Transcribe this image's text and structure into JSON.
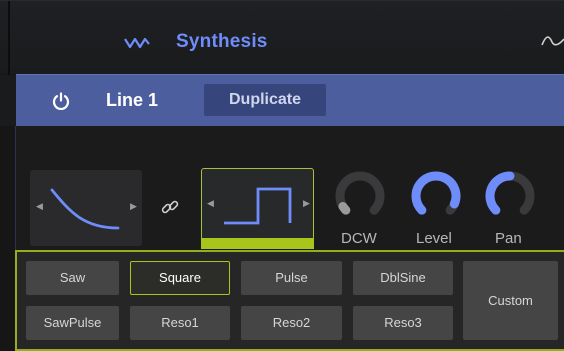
{
  "header": {
    "title": "Synthesis"
  },
  "line": {
    "title": "Line 1",
    "duplicate_label": "Duplicate"
  },
  "knobs": [
    {
      "label": "DCW",
      "level": 0.05,
      "color": "#9a9a9a"
    },
    {
      "label": "Level",
      "level": 0.92,
      "color": "#6f8dfa"
    },
    {
      "label": "Pan",
      "level": 0.5,
      "color": "#6f8dfa"
    }
  ],
  "waveforms": {
    "row1": [
      "Saw",
      "Square",
      "Pulse",
      "DblSine"
    ],
    "row2": [
      "SawPulse",
      "Reso1",
      "Reso2",
      "Reso3"
    ],
    "custom": "Custom",
    "selected": "Square"
  },
  "colors": {
    "accent": "#6f8dfa",
    "line_bar": "#4c5e9e",
    "highlight": "#a8c51c"
  },
  "icons": [
    "synthesis-icon",
    "waveform-icon",
    "power-icon",
    "link-icon",
    "decay-shape-icon",
    "square-shape-icon",
    "arrow-left-icon",
    "arrow-right-icon"
  ]
}
